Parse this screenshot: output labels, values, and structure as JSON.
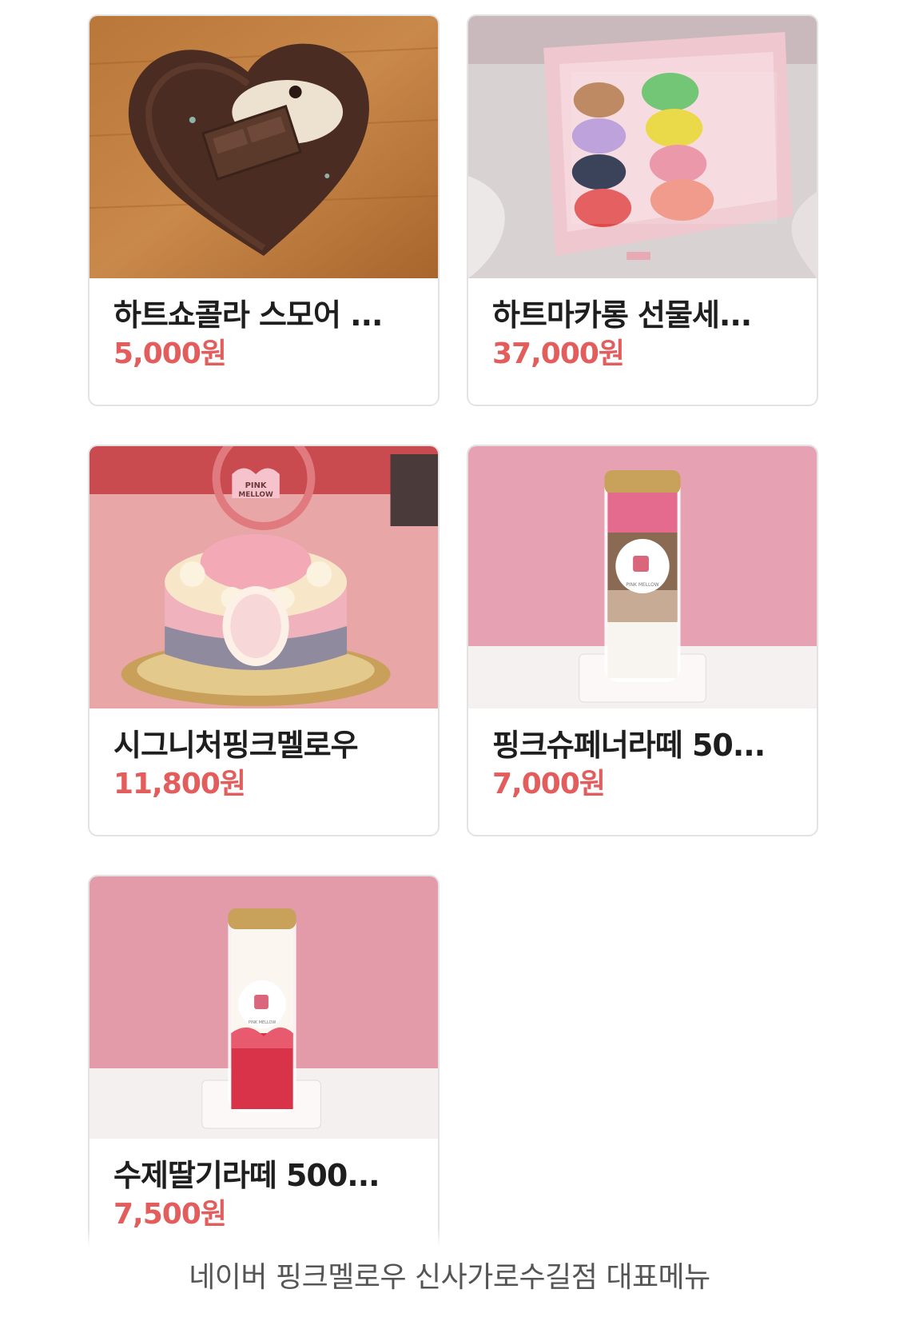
{
  "menu_items": [
    {
      "name": "하트쇼콜라 스모어 ...",
      "price": "5,000원",
      "image": "heart-chocolate-smore-cookie"
    },
    {
      "name": "하트마카롱 선물세...",
      "price": "37,000원",
      "image": "heart-macaron-gift-box"
    },
    {
      "name": "시그니처핑크멜로우",
      "price": "11,800원",
      "image": "signature-pink-mellow-cake"
    },
    {
      "name": "핑크슈페너라떼 50...",
      "price": "7,000원",
      "image": "pink-einspanner-latte-bottle"
    },
    {
      "name": "수제딸기라떼 500...",
      "price": "7,500원",
      "image": "strawberry-latte-bottle"
    }
  ],
  "caption": "네이버 핑크멜로우 신사가로수길점 대표메뉴",
  "colors": {
    "price": "#e35d5d",
    "name": "#1e1e1e",
    "card_border": "#e3e3e3",
    "caption": "#555555"
  }
}
